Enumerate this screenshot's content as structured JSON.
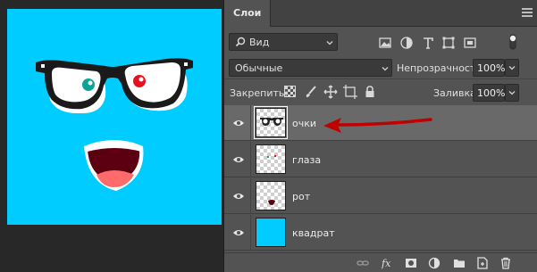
{
  "panel": {
    "tab_label": "Слои",
    "menu_icon": "hamburger-icon"
  },
  "filter": {
    "kind_label": "Вид",
    "search_icon": "search-icon"
  },
  "blend": {
    "mode_label": "Обычные",
    "opacity_label": "Непрозрачность:",
    "opacity_value": "100%"
  },
  "lock": {
    "label": "Закрепить:",
    "fill_label": "Заливка:",
    "fill_value": "100%"
  },
  "layers": [
    {
      "name": "очки",
      "selected": true,
      "visible": true
    },
    {
      "name": "глаза",
      "selected": false,
      "visible": true
    },
    {
      "name": "рот",
      "selected": false,
      "visible": true
    },
    {
      "name": "квадрат",
      "selected": false,
      "visible": true
    }
  ],
  "colors": {
    "artboard": "#00ccff",
    "panel_bg": "#535353",
    "selected_row": "#696969",
    "annotation_arrow": "#cc0000"
  },
  "footer_icons": [
    "link-icon",
    "fx-icon",
    "mask-icon",
    "adjustment-icon",
    "folder-icon",
    "new-layer-icon",
    "trash-icon"
  ]
}
